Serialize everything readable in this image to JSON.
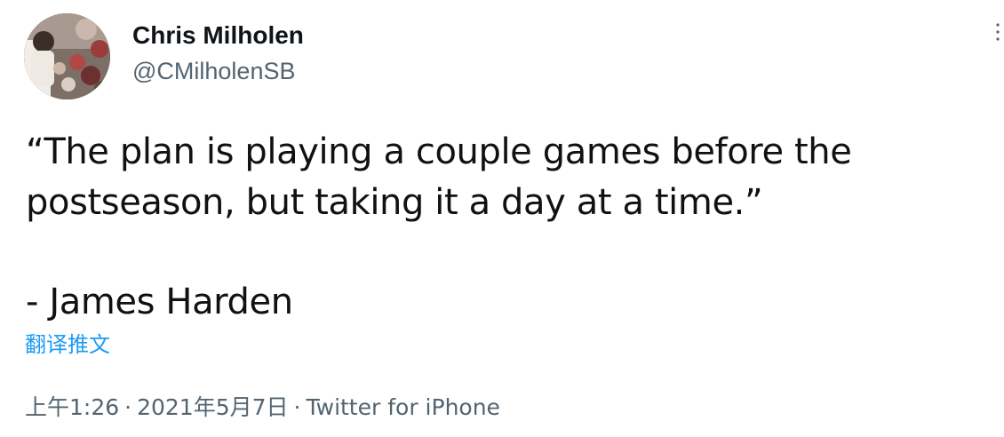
{
  "author": {
    "display_name": "Chris Milholen",
    "handle": "@CMilholenSB"
  },
  "tweet": {
    "text_lines": [
      "“The plan is playing a couple games before the",
      "postseason, but taking it a day at a time.”"
    ],
    "attribution": "- James Harden",
    "translate_label": "翻译推文"
  },
  "meta": {
    "time": "上午1:26",
    "separator": "·",
    "date": "2021年5月7日",
    "source": "Twitter for iPhone"
  },
  "icons": {
    "more": "more-options-icon",
    "avatar": "profile-photo"
  },
  "colors": {
    "text": "#0f1419",
    "secondary": "#536471",
    "link": "#1d9bf0"
  }
}
